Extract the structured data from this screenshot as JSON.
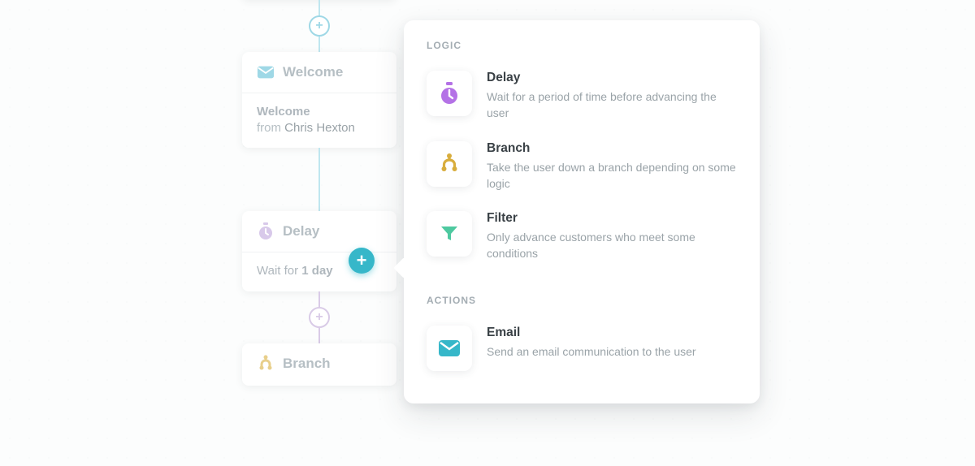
{
  "flow": {
    "cards": [
      {
        "id": "welcome-card",
        "title": "Welcome",
        "body_label": "Welcome",
        "from_prefix": "from ",
        "from_name": "Chris Hexton",
        "icon": "mail",
        "icon_color": "#36b7c9"
      },
      {
        "id": "delay-card",
        "title": "Delay",
        "wait_prefix": "Wait for ",
        "wait_value": "1 day",
        "icon": "stopwatch",
        "icon_color": "#c7a6e8"
      },
      {
        "id": "branch-card",
        "title": "Branch",
        "icon": "branch",
        "icon_color": "#e0ba4b"
      }
    ]
  },
  "popover": {
    "sections": {
      "logic": {
        "label": "LOGIC"
      },
      "actions": {
        "label": "ACTIONS"
      }
    },
    "options": {
      "delay": {
        "name": "Delay",
        "desc": "Wait for a period of time before advancing the user",
        "icon": "stopwatch",
        "color": "#b472e6"
      },
      "branch": {
        "name": "Branch",
        "desc": "Take the user down a branch depending on some logic",
        "icon": "branch",
        "color": "#d8ad3d"
      },
      "filter": {
        "name": "Filter",
        "desc": "Only advance customers who meet some conditions",
        "icon": "funnel",
        "color": "#4ec9a0"
      },
      "email": {
        "name": "Email",
        "desc": "Send an email communication to the user",
        "icon": "mail",
        "color": "#36b7c9"
      }
    }
  },
  "colors": {
    "accent": "#36b7c9"
  }
}
